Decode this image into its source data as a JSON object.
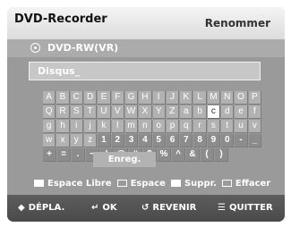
{
  "header": {
    "title": "DVD-Recorder",
    "mode": "Renommer"
  },
  "disc": {
    "label": "DVD-RW(VR)"
  },
  "name_field": {
    "value": "Disqus_"
  },
  "keyboard": {
    "rows": [
      [
        "A",
        "B",
        "C",
        "D",
        "E",
        "F",
        "G",
        "H",
        "I",
        "J",
        "K",
        "L",
        "M",
        "N",
        "O",
        "P"
      ],
      [
        "Q",
        "R",
        "S",
        "T",
        "U",
        "V",
        "W",
        "X",
        "Y",
        "Z",
        "a",
        "b",
        "c",
        "d",
        "e",
        "f"
      ],
      [
        "g",
        "h",
        "i",
        "j",
        "k",
        "l",
        "m",
        "n",
        "o",
        "p",
        "q",
        "r",
        "s",
        "t",
        "u",
        "v"
      ],
      [
        "w",
        "x",
        "y",
        "z",
        "1",
        "2",
        "3",
        "4",
        "5",
        "6",
        "7",
        "8",
        "9",
        "0",
        "-",
        "_"
      ],
      [
        "+",
        "=",
        ".",
        "~",
        "!",
        "@",
        "#",
        "$",
        "%",
        "^",
        "&",
        "(",
        ")"
      ]
    ],
    "selected_key": "c"
  },
  "enreg_label": "Enreg.",
  "help": {
    "espace_libre": "Espace Libre",
    "espace": "Espace",
    "suppr": "Suppr.",
    "effacer": "Effacer"
  },
  "footer": {
    "depla": "DÉPLA.",
    "ok": "OK",
    "revenir": "REVENIR",
    "quitter": "QUITTER"
  },
  "colors": {
    "panel": "#9a9a9a",
    "header": "#dcdcdc",
    "footer": "#4a4a4a"
  }
}
